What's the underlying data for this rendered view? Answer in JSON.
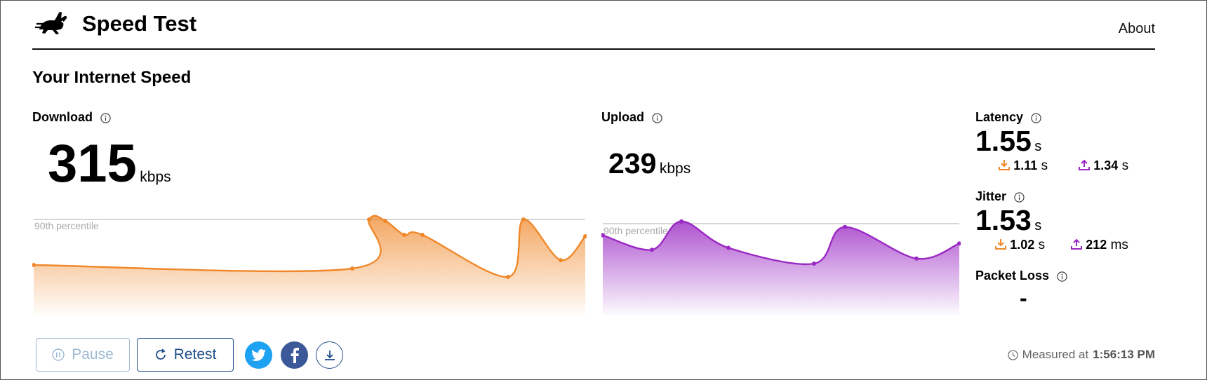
{
  "header": {
    "brand": "Speed Test",
    "about_label": "About"
  },
  "page_title": "Your Internet Speed",
  "download": {
    "label": "Download",
    "value": "315",
    "unit": "kbps",
    "percentile_label": "90th percentile",
    "color": "#f0882a"
  },
  "upload": {
    "label": "Upload",
    "value": "239",
    "unit": "kbps",
    "percentile_label": "90th percentile",
    "color": "#9a28c4"
  },
  "latency": {
    "label": "Latency",
    "value": "1.55",
    "unit": "s",
    "down_value": "1.11",
    "down_unit": "s",
    "up_value": "1.34",
    "up_unit": "s"
  },
  "jitter": {
    "label": "Jitter",
    "value": "1.53",
    "unit": "s",
    "down_value": "1.02",
    "down_unit": "s",
    "up_value": "212",
    "up_unit": "ms"
  },
  "packet_loss": {
    "label": "Packet Loss",
    "value": "-"
  },
  "buttons": {
    "pause_label": "Pause",
    "retest_label": "Retest"
  },
  "measured": {
    "prefix": "Measured at",
    "time": "1:56:13 PM"
  },
  "icons": [
    "rabbit-logo-icon",
    "info-icon",
    "pause-icon",
    "refresh-icon",
    "twitter-icon",
    "facebook-icon",
    "download-icon",
    "clock-icon",
    "arrow-down-icon",
    "arrow-up-icon"
  ],
  "chart_data": [
    {
      "type": "area",
      "series": [
        {
          "name": "Download",
          "values": [
            0.35,
            0.3,
            1.0,
            0.98,
            0.78,
            0.78,
            0.18,
            1.0,
            0.42,
            0.76
          ]
        }
      ]
    },
    {
      "type": "area",
      "series": [
        {
          "name": "Upload",
          "values": [
            0.75,
            0.52,
            0.97,
            0.55,
            0.3,
            0.88,
            0.38,
            0.62
          ]
        }
      ]
    }
  ]
}
